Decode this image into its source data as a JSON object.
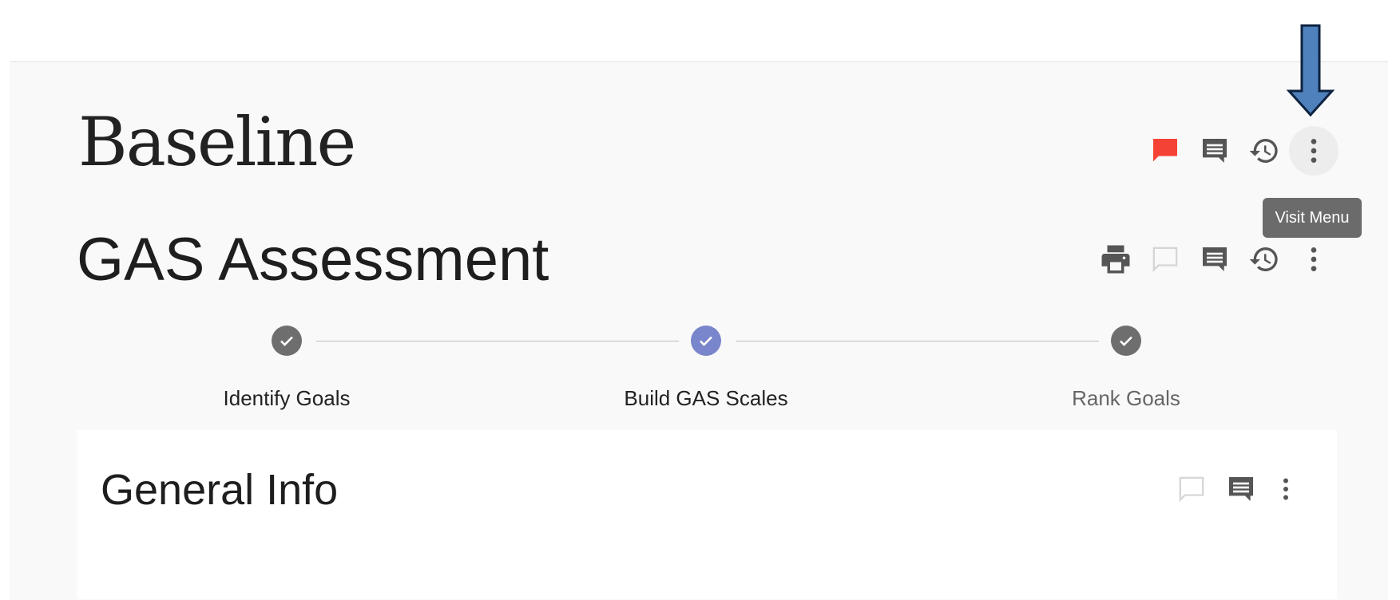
{
  "page": {
    "title": "Baseline",
    "subtitle": "GAS Assessment"
  },
  "top_toolbar": {
    "icons": [
      "flag-icon",
      "comment-icon",
      "history-icon",
      "more-vert-icon"
    ],
    "flag_color": "#f44336"
  },
  "tooltip": {
    "text": "Visit Menu"
  },
  "assessment_toolbar": {
    "icons": [
      "print-icon",
      "comment-outline-icon",
      "comment-icon",
      "history-icon",
      "more-vert-icon"
    ]
  },
  "stepper": {
    "steps": [
      {
        "label": "Identify Goals",
        "color": "#6e6e6e",
        "active": false
      },
      {
        "label": "Build GAS Scales",
        "color": "#7986cb",
        "active": true
      },
      {
        "label": "Rank Goals",
        "color": "#6e6e6e",
        "active": false
      }
    ]
  },
  "general_info": {
    "title": "General Info",
    "icons": [
      "comment-outline-icon",
      "comment-icon",
      "more-vert-icon"
    ]
  },
  "annotation": {
    "arrow_color": "#4f81bd"
  }
}
